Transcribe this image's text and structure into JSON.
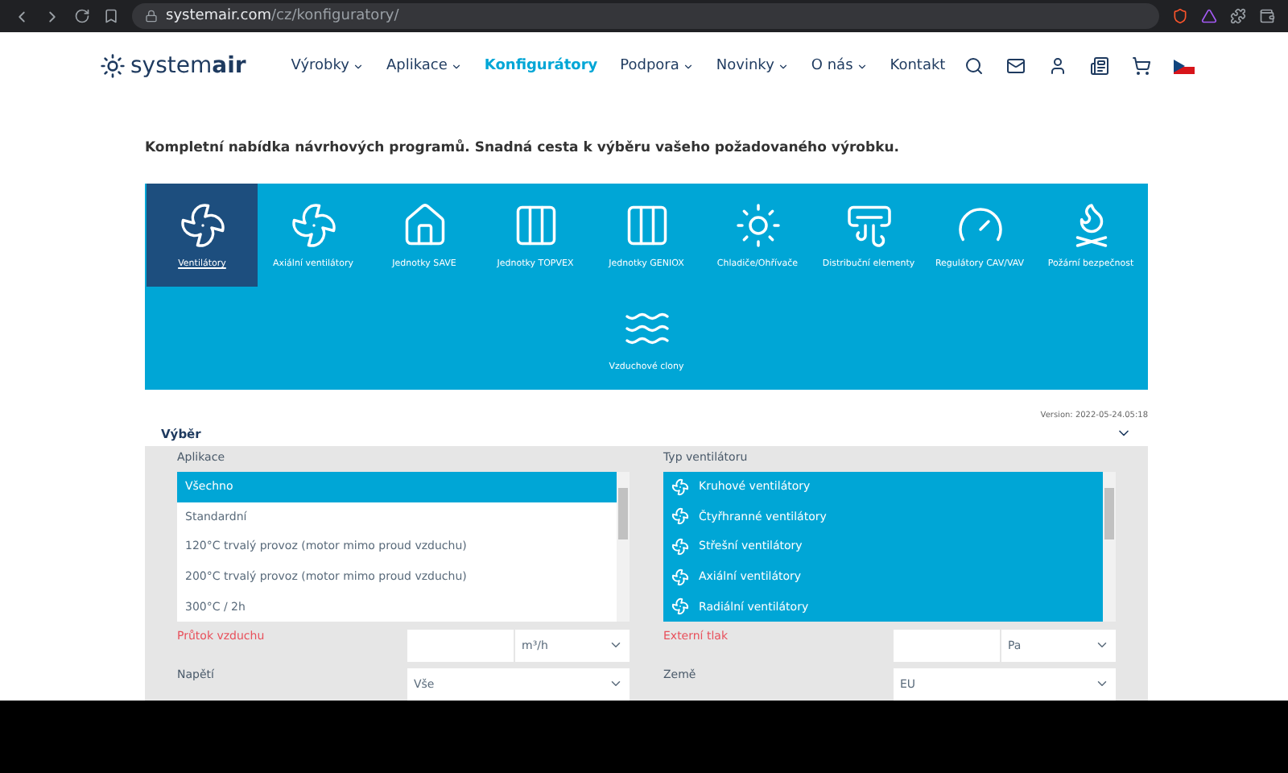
{
  "browser": {
    "url_host": "systemair.com",
    "url_path": "/cz/konfiguratory/"
  },
  "nav": {
    "logo": {
      "light": "system",
      "bold": "air"
    },
    "items": [
      {
        "label": "Výrobky",
        "caret": true,
        "selected": false
      },
      {
        "label": "Aplikace",
        "caret": true,
        "selected": false
      },
      {
        "label": "Konfigurátory",
        "caret": false,
        "selected": true
      },
      {
        "label": "Podpora",
        "caret": true,
        "selected": false
      },
      {
        "label": "Novinky",
        "caret": true,
        "selected": false
      },
      {
        "label": "O nás",
        "caret": true,
        "selected": false
      },
      {
        "label": "Kontakt",
        "caret": false,
        "selected": false
      }
    ]
  },
  "heading": "Kompletní nabídka návrhových programů. Snadná cesta k výběru vašeho požadovaného výrobku.",
  "categories": [
    {
      "label": "Ventilátory",
      "selected": true
    },
    {
      "label": "Axiální ventilátory",
      "selected": false
    },
    {
      "label": "Jednotky SAVE",
      "selected": false
    },
    {
      "label": "Jednotky TOPVEX",
      "selected": false
    },
    {
      "label": "Jednotky GENIOX",
      "selected": false
    },
    {
      "label": "Chladiče/Ohřívače",
      "selected": false
    },
    {
      "label": "Distribuční elementy",
      "selected": false
    },
    {
      "label": "Regulátory CAV/VAV",
      "selected": false
    },
    {
      "label": "Požární bezpečnost",
      "selected": false
    },
    {
      "label": "Vzduchové clony",
      "selected": false
    }
  ],
  "version": "Version: 2022-05-24.05:18",
  "section": {
    "title": "Výběr",
    "expanded": true
  },
  "application": {
    "label": "Aplikace",
    "options": [
      {
        "label": "Všechno",
        "selected": true
      },
      {
        "label": "Standardní",
        "selected": false
      },
      {
        "label": "120°C trvalý provoz (motor mimo proud vzduchu)",
        "selected": false
      },
      {
        "label": "200°C trvalý provoz (motor mimo proud vzduchu)",
        "selected": false
      },
      {
        "label": "300°C / 2h",
        "selected": false
      }
    ]
  },
  "fan_type": {
    "label": "Typ ventilátoru",
    "options": [
      {
        "label": "Kruhové ventilátory",
        "selected": true
      },
      {
        "label": "Čtyřhranné ventilátory",
        "selected": true
      },
      {
        "label": "Střešní ventilátory",
        "selected": true
      },
      {
        "label": "Axiální ventilátory",
        "selected": true
      },
      {
        "label": "Radiální ventilátory",
        "selected": true
      }
    ]
  },
  "fields": [
    {
      "kind": "unit",
      "label": "Průtok vzduchu",
      "required": true,
      "unit": "m³/h"
    },
    {
      "kind": "unit",
      "label": "Externí tlak",
      "required": true,
      "unit": "Pa"
    },
    {
      "kind": "select",
      "label": "Napětí",
      "required": false,
      "value": "Vše"
    },
    {
      "kind": "select",
      "label": "Země",
      "required": false,
      "value": "EU"
    }
  ]
}
